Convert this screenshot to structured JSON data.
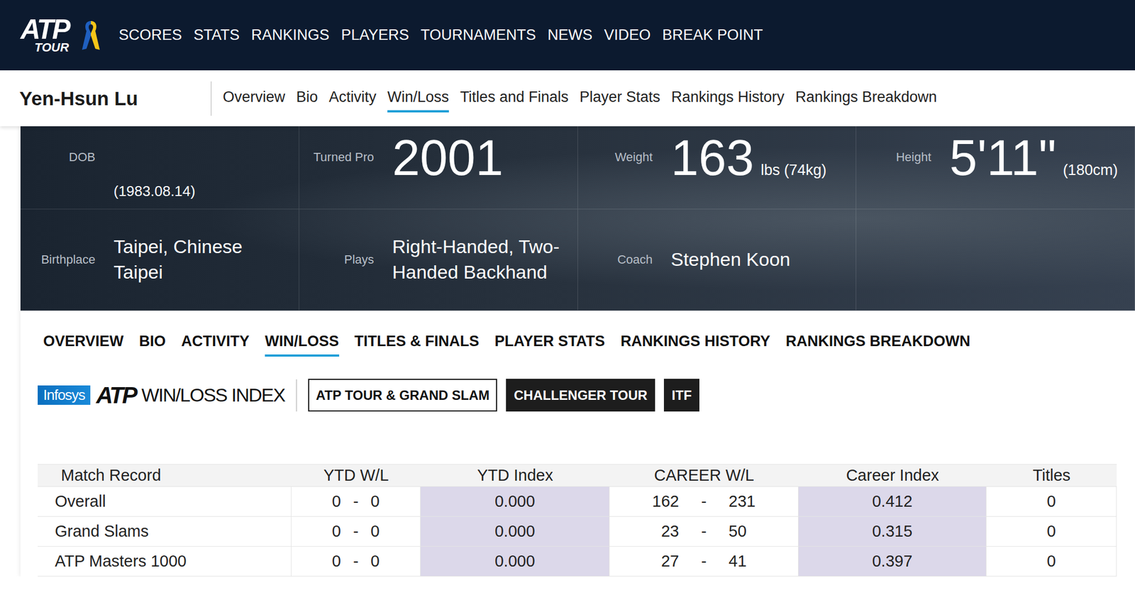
{
  "nav": {
    "logo": {
      "mark": "ATP",
      "sub": "TOUR"
    },
    "items": [
      "SCORES",
      "STATS",
      "RANKINGS",
      "PLAYERS",
      "TOURNAMENTS",
      "NEWS",
      "VIDEO",
      "BREAK POINT"
    ]
  },
  "player": {
    "name": "Yen-Hsun Lu"
  },
  "player_tabs": [
    {
      "label": "Overview",
      "selected": false
    },
    {
      "label": "Bio",
      "selected": false
    },
    {
      "label": "Activity",
      "selected": false
    },
    {
      "label": "Win/Loss",
      "selected": true
    },
    {
      "label": "Titles and Finals",
      "selected": false
    },
    {
      "label": "Player Stats",
      "selected": false
    },
    {
      "label": "Rankings History",
      "selected": false
    },
    {
      "label": "Rankings Breakdown",
      "selected": false
    }
  ],
  "profile": {
    "cells": [
      {
        "kind": "date",
        "label": "DOB",
        "value": "(1983.08.14)"
      },
      {
        "kind": "big",
        "label": "Turned Pro",
        "value": "2001"
      },
      {
        "kind": "big",
        "label": "Weight",
        "value": "163",
        "unit": "lbs (74kg)"
      },
      {
        "kind": "big",
        "label": "Height",
        "value": "5'11\"",
        "unit": "(180cm)"
      },
      {
        "kind": "text",
        "label": "Birthplace",
        "value": "Taipei, Chinese Taipei"
      },
      {
        "kind": "text",
        "label": "Plays",
        "value": "Right-Handed, Two-Handed Backhand"
      },
      {
        "kind": "text",
        "label": "Coach",
        "value": "Stephen Koon"
      },
      {
        "kind": "empty"
      }
    ]
  },
  "section_tabs": [
    {
      "label": "OVERVIEW",
      "selected": false
    },
    {
      "label": "BIO",
      "selected": false
    },
    {
      "label": "ACTIVITY",
      "selected": false
    },
    {
      "label": "WIN/LOSS",
      "selected": true
    },
    {
      "label": "TITLES & FINALS",
      "selected": false
    },
    {
      "label": "PLAYER STATS",
      "selected": false
    },
    {
      "label": "RANKINGS HISTORY",
      "selected": false
    },
    {
      "label": "RANKINGS BREAKDOWN",
      "selected": false
    }
  ],
  "index": {
    "brand": "Infosys",
    "logo": "ATP",
    "title": "WIN/LOSS INDEX",
    "filters": [
      {
        "label": "ATP TOUR & GRAND SLAM",
        "selected": true
      },
      {
        "label": "CHALLENGER TOUR",
        "selected": false
      },
      {
        "label": "ITF",
        "selected": false
      }
    ]
  },
  "table": {
    "columns": [
      "Match Record",
      "YTD W/L",
      "YTD Index",
      "CAREER W/L",
      "Career Index",
      "Titles"
    ],
    "separator": "-",
    "rows": [
      {
        "label": "Overall",
        "ytd_w": "0",
        "ytd_l": "0",
        "ytd_index": "0.000",
        "career_w": "162",
        "career_l": "231",
        "career_index": "0.412",
        "titles": "0"
      },
      {
        "label": "Grand Slams",
        "ytd_w": "0",
        "ytd_l": "0",
        "ytd_index": "0.000",
        "career_w": "23",
        "career_l": "50",
        "career_index": "0.315",
        "titles": "0"
      },
      {
        "label": "ATP Masters 1000",
        "ytd_w": "0",
        "ytd_l": "0",
        "ytd_index": "0.000",
        "career_w": "27",
        "career_l": "41",
        "career_index": "0.397",
        "titles": "0"
      }
    ]
  }
}
